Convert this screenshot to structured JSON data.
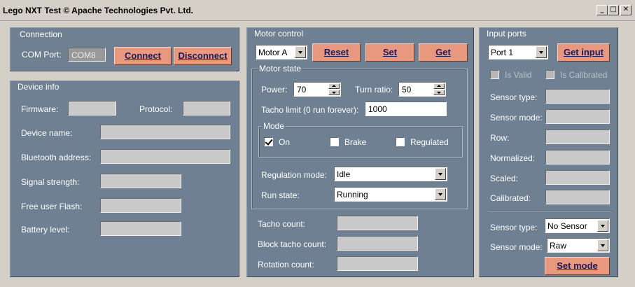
{
  "window": {
    "title": "Lego NXT Test © Apache Technologies Pvt. Ltd.",
    "minimize_glyph": "_",
    "maximize_glyph": "□",
    "close_glyph": "✕"
  },
  "connection": {
    "legend": "Connection",
    "com_port_label": "COM Port:",
    "com_port_value": "COM8",
    "connect_label": "Connect",
    "disconnect_label": "Disconnect"
  },
  "device_info": {
    "legend": "Device info",
    "firmware_label": "Firmware:",
    "protocol_label": "Protocol:",
    "device_name_label": "Device name:",
    "bluetooth_label": "Bluetooth address:",
    "signal_label": "Signal strength:",
    "flash_label": "Free user Flash:",
    "battery_label": "Battery level:"
  },
  "motor_control": {
    "legend": "Motor control",
    "motor_select": "Motor A",
    "reset_label": "Reset",
    "set_label": "Set",
    "get_label": "Get",
    "motor_state": {
      "legend": "Motor state",
      "power_label": "Power:",
      "power_value": "70",
      "turn_ratio_label": "Turn ratio:",
      "turn_ratio_value": "50",
      "tacho_limit_label": "Tacho limit (0 run forever):",
      "tacho_limit_value": "1000",
      "mode": {
        "legend": "Mode",
        "on_label": "On",
        "on_checked": true,
        "brake_label": "Brake",
        "brake_checked": false,
        "regulated_label": "Regulated",
        "regulated_checked": false
      },
      "regulation_mode_label": "Regulation mode:",
      "regulation_mode_value": "Idle",
      "run_state_label": "Run state:",
      "run_state_value": "Running"
    },
    "tacho_count_label": "Tacho count:",
    "block_tacho_label": "Block tacho count:",
    "rotation_count_label": "Rotation count:"
  },
  "input_ports": {
    "legend": "Input ports",
    "port_select": "Port 1",
    "get_input_label": "Get input",
    "is_valid_label": "Is Valid",
    "is_calibrated_label": "Is Calibrated",
    "sensor_type_label": "Sensor type:",
    "sensor_mode_label": "Sensor mode:",
    "row_label": "Row:",
    "normalized_label": "Normalized:",
    "scaled_label": "Scaled:",
    "calibrated_label": "Calibrated:",
    "set_sensor_type_label": "Sensor type:",
    "set_sensor_type_value": "No Sensor",
    "set_sensor_mode_label": "Sensor mode:",
    "set_sensor_mode_value": "Raw",
    "set_mode_label": "Set mode"
  },
  "colors": {
    "panel": "#6e8092",
    "button": "#e8987e",
    "button_text": "#1a1a5a",
    "window_chrome": "#d4d0c8"
  }
}
